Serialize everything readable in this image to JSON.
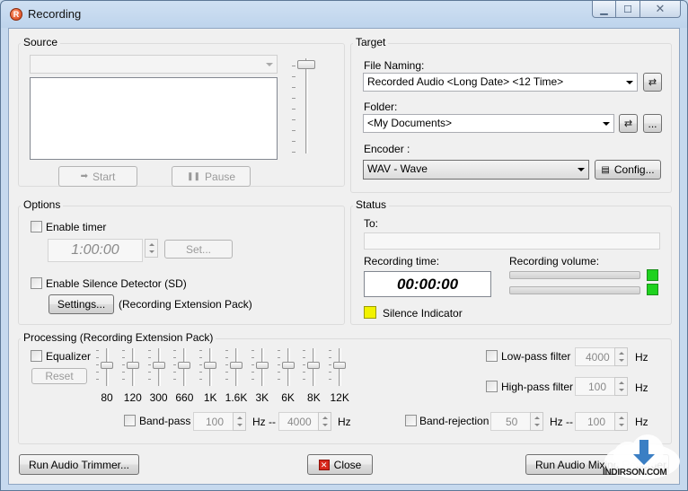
{
  "window": {
    "title": "Recording",
    "app_icon": "record-icon",
    "caption_icons": [
      "minimize-icon",
      "maximize-icon",
      "close-icon"
    ]
  },
  "source": {
    "title": "Source",
    "device_combo_value": "",
    "start_label": "Start",
    "pause_label": "Pause",
    "volume_level": 1.0
  },
  "target": {
    "title": "Target",
    "file_naming_label": "File Naming:",
    "file_naming_value": "Recorded Audio <Long Date> <12 Time>",
    "folder_label": "Folder:",
    "folder_value": "<My Documents>",
    "browse_label": "...",
    "encoder_label": "Encoder :",
    "encoder_value": "WAV - Wave",
    "config_label": "Config..."
  },
  "options": {
    "title": "Options",
    "enable_timer_label": "Enable timer",
    "timer_value": "1:00:00",
    "set_label": "Set...",
    "silence_detector_label": "Enable Silence Detector (SD)",
    "settings_label": "Settings...",
    "extension_note": "(Recording Extension Pack)"
  },
  "status": {
    "title": "Status",
    "to_label": "To:",
    "to_value": "",
    "recording_time_label": "Recording time:",
    "recording_time_value": "00:00:00",
    "recording_volume_label": "Recording volume:",
    "volume_levels": [
      0,
      0
    ],
    "silence_indicator_label": "Silence Indicator",
    "colors": {
      "volume_indicator": "#1fd21f",
      "silence_indicator": "#f2f200"
    }
  },
  "processing": {
    "title": "Processing (Recording Extension Pack)",
    "equalizer_label": "Equalizer",
    "reset_label": "Reset",
    "bands": [
      "80",
      "120",
      "300",
      "660",
      "1K",
      "1.6K",
      "3K",
      "6K",
      "8K",
      "12K"
    ],
    "low_pass_label": "Low-pass filter",
    "low_pass_value": "4000",
    "high_pass_label": "High-pass filter",
    "high_pass_value": "100",
    "hz": "Hz",
    "band_pass_label": "Band-pass",
    "band_pass_from": "100",
    "band_pass_to": "4000",
    "hz_sep": "Hz --",
    "band_rejection_label": "Band-rejection",
    "band_rejection_from": "50",
    "band_rejection_to": "100"
  },
  "footer": {
    "trimmer_label": "Run Audio Trimmer...",
    "close_label": "Close",
    "mixing_label": "Run Audio Mixing Recorder..."
  },
  "watermark": {
    "text": "INDIRSON.COM"
  }
}
